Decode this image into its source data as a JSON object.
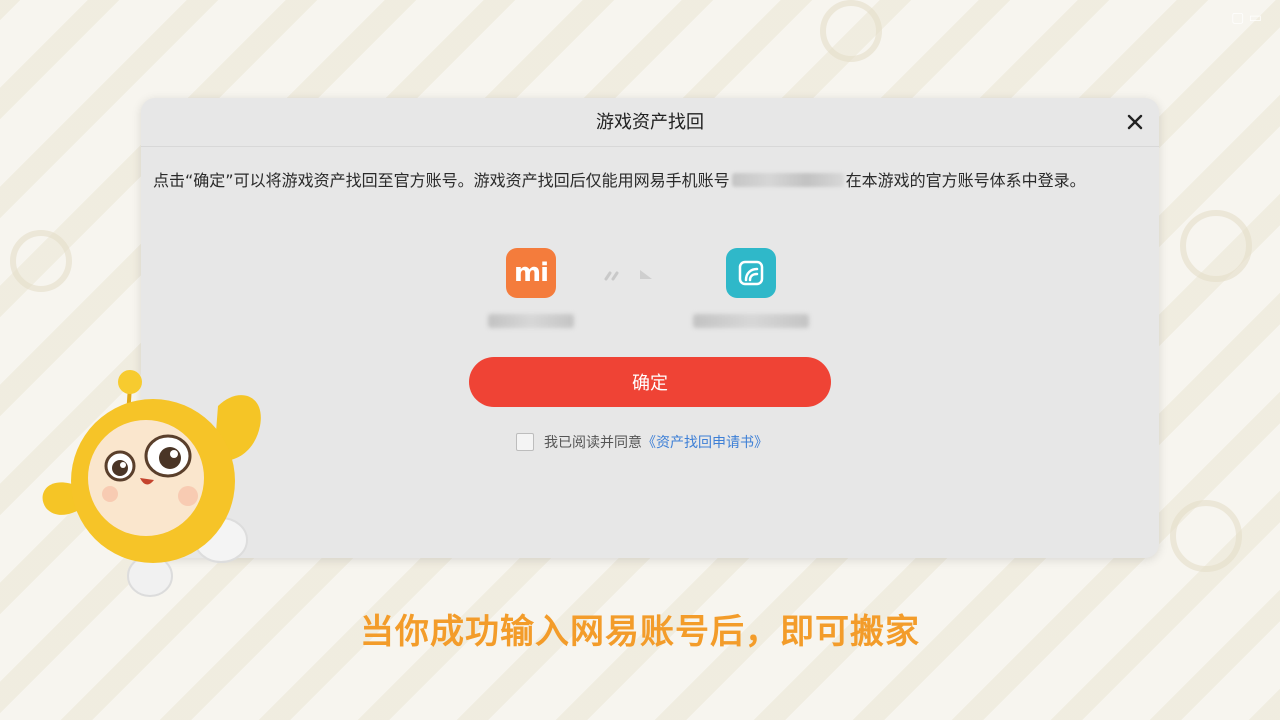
{
  "dialog": {
    "title": "游戏资产找回",
    "description_part1": "点击“确定”可以将游戏资产找回至官方账号。游戏资产找回后仅能用网易手机账号",
    "description_part2": "在本游戏的官方账号体系中登录。",
    "from_account": {
      "icon": "xiaomi-icon",
      "icon_text": "mi"
    },
    "to_account": {
      "icon": "netease-icon"
    },
    "confirm_label": "确定",
    "agree_text": "我已阅读并同意",
    "agree_link": "《资产找回申请书》"
  },
  "caption": "当你成功输入网易账号后，即可搬家",
  "colors": {
    "confirm": "#ef4335",
    "link": "#3d7fd6",
    "caption": "#f39c2a",
    "xiaomi": "#f47c3c",
    "netease": "#2fb8c9"
  }
}
